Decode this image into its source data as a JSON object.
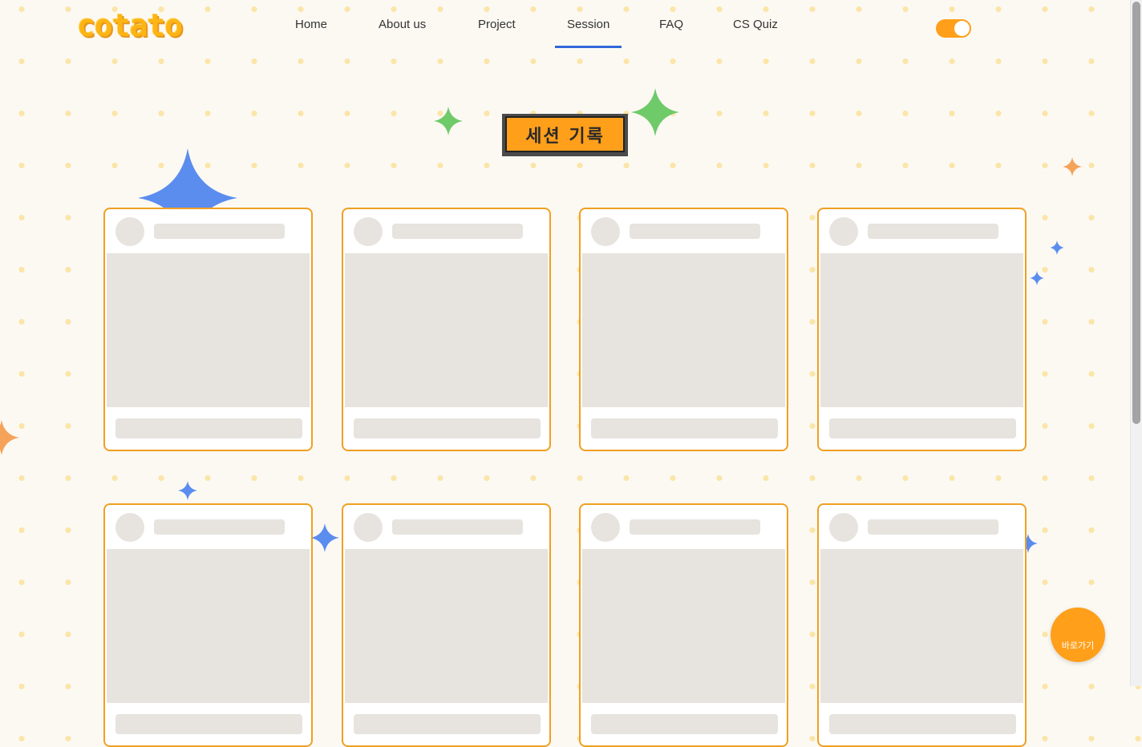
{
  "logo": {
    "text": "cotato"
  },
  "nav": {
    "items": [
      {
        "label": "Home"
      },
      {
        "label": "About us"
      },
      {
        "label": "Project"
      },
      {
        "label": "Session",
        "active": true
      },
      {
        "label": "FAQ"
      },
      {
        "label": "CS Quiz"
      }
    ]
  },
  "theme_toggle": {
    "state": "on"
  },
  "section_title": "세션 기록",
  "cards": {
    "count": 8,
    "state": "loading-skeleton"
  },
  "shortcut_button": {
    "label": "바로가기"
  },
  "colors": {
    "accent": "#ff9f1a",
    "card_border": "#f0a022",
    "nav_active": "#2f68d8",
    "skeleton": "#e7e3de",
    "background": "#fcf9f3",
    "dot": "#fbe5a7",
    "sparkle_blue": "#5b8def",
    "sparkle_green": "#6fca6a",
    "sparkle_orange": "#f6a35a"
  },
  "icons": [
    "sparkle-icon",
    "toggle-switch"
  ]
}
